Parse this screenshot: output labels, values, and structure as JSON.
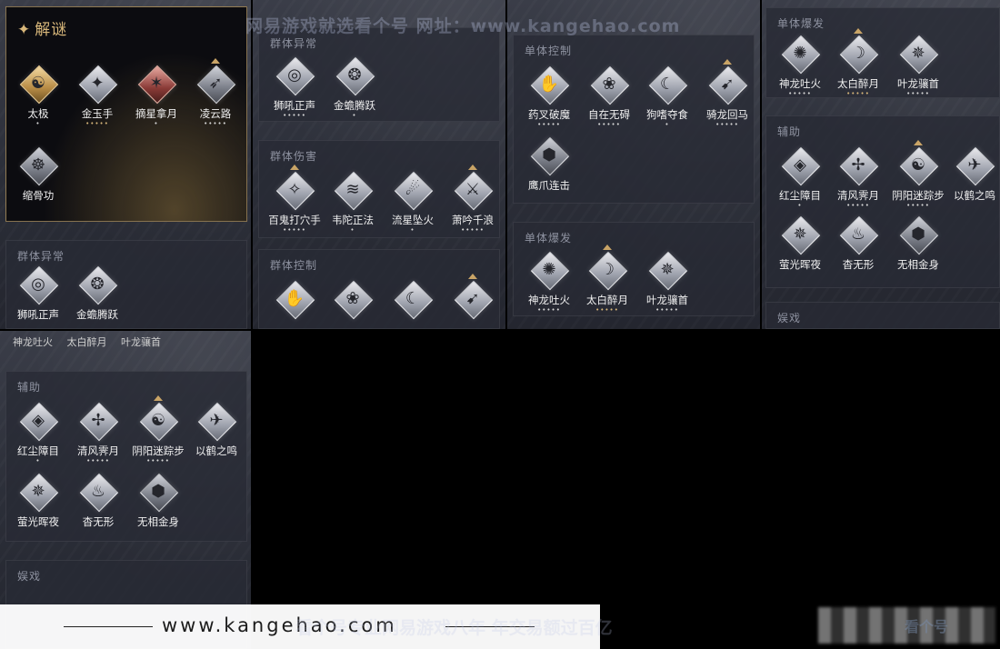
{
  "watermarks": {
    "top": "网易游戏就选看个号   网址：www.kangehao.com",
    "bottom": "看个号专业网易游戏八年   年交易额过百亿",
    "footer_url": "www.kangehao.com",
    "logo_text": "看个号"
  },
  "panels": {
    "jiemi": {
      "title": "解谜",
      "icon": "✦"
    },
    "qunti_yichang": "群体异常",
    "qunti_shanghai": "群体伤害",
    "qunti_kongzhi": "群体控制",
    "danti_kongzhi": "单体控制",
    "danti_baofa": "单体爆发",
    "fuzhu": "辅助",
    "yuxi": "娱戏"
  },
  "skills": {
    "taiji": {
      "name": "太极",
      "dots": "•",
      "glyph": "☯"
    },
    "jinyushou": {
      "name": "金玉手",
      "dots": "•••••",
      "glyph": "✦"
    },
    "zhexingnayue": {
      "name": "摘星拿月",
      "dots": "•",
      "glyph": "✶"
    },
    "lingyunlu": {
      "name": "凌云路",
      "dots": "•••••",
      "glyph": "➶"
    },
    "suogugong": {
      "name": "缩骨功",
      "dots": "",
      "glyph": "☸"
    },
    "shihouzhengsheng": {
      "name": "狮吼正声",
      "dots": "•••••",
      "glyph": "◎"
    },
    "jinchantengyue": {
      "name": "金蟾腾跃",
      "dots": "•",
      "glyph": "❂"
    },
    "baiguidaxueshou": {
      "name": "百鬼打穴手",
      "dots": "•••••",
      "glyph": "✧"
    },
    "weituozhengfa": {
      "name": "韦陀正法",
      "dots": "•",
      "glyph": "≋"
    },
    "liuxingzhuihuo": {
      "name": "流星坠火",
      "dots": "•",
      "glyph": "☄"
    },
    "xiaoyinqianlang": {
      "name": "萧吟千浪",
      "dots": "•••••",
      "glyph": "⚔"
    },
    "yaochapomo": {
      "name": "药叉破魔",
      "dots": "•••••",
      "glyph": "✋"
    },
    "zizaiwuai": {
      "name": "自在无碍",
      "dots": "•••••",
      "glyph": "❀"
    },
    "goushiduoshi": {
      "name": "狗嗜夺食",
      "dots": "•",
      "glyph": "☾"
    },
    "qilonghuima": {
      "name": "骑龙回马",
      "dots": "•••••",
      "glyph": "➹"
    },
    "yingzhaolianji": {
      "name": "鹰爪连击",
      "dots": "",
      "glyph": "⬢"
    },
    "shenlongtuhuo": {
      "name": "神龙吐火",
      "dots": "•••••",
      "glyph": "✺"
    },
    "taibaizuiyue": {
      "name": "太白醉月",
      "dots": "•••••",
      "glyph": "☽"
    },
    "yelongxiangshou": {
      "name": "叶龙骧首",
      "dots": "•••••",
      "glyph": "✵"
    },
    "hongchenzhangmu": {
      "name": "红尘障目",
      "dots": "•",
      "glyph": "◈"
    },
    "qingfengjiyue": {
      "name": "清风霁月",
      "dots": "•••••",
      "glyph": "✢"
    },
    "yinyangmizongbu": {
      "name": "阴阳迷踪步",
      "dots": "•••••",
      "glyph": "☯"
    },
    "yihezhiming": {
      "name": "以鹤之鸣",
      "dots": "",
      "glyph": "✈"
    },
    "yingguanghuiye": {
      "name": "萤光晖夜",
      "dots": "",
      "glyph": "✵"
    },
    "xingwuxing": {
      "name": "杳无形",
      "dots": "",
      "glyph": "♨"
    },
    "wuxiangjinshen": {
      "name": "无相金身",
      "dots": "",
      "glyph": "⬢"
    }
  },
  "colors": {
    "gold": "#d8b77a",
    "panel": "#2b2e38"
  }
}
